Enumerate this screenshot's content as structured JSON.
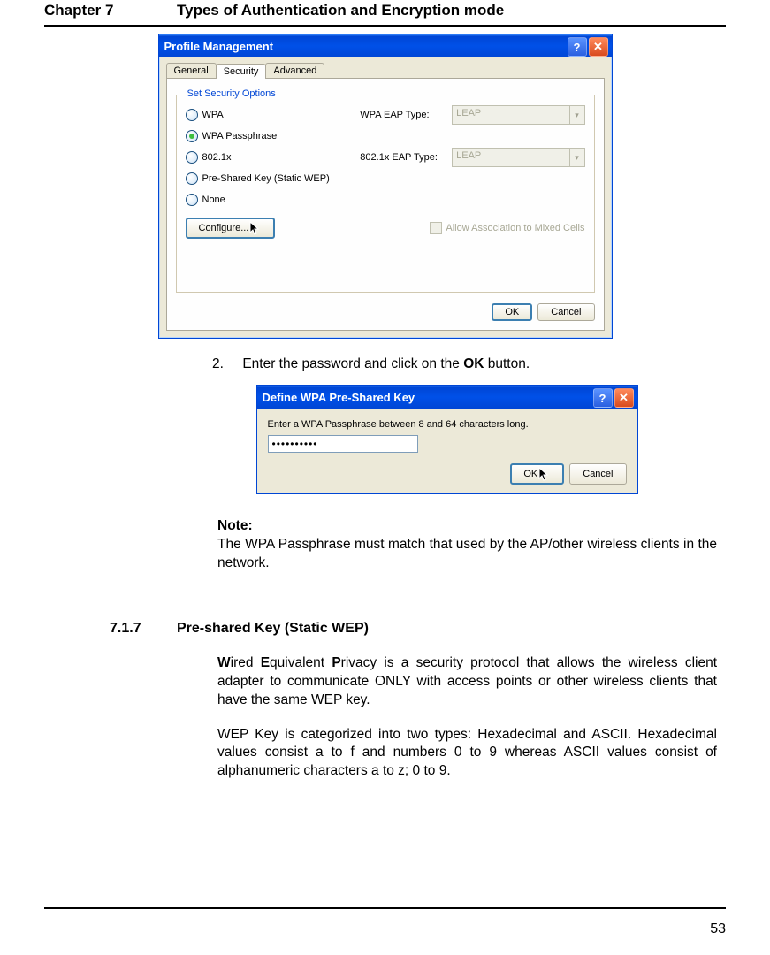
{
  "header": {
    "chapter": "Chapter 7",
    "title": "Types of Authentication and Encryption mode"
  },
  "dialog1": {
    "title": "Profile Management",
    "help_glyph": "?",
    "close_glyph": "✕",
    "tabs": {
      "general": "General",
      "security": "Security",
      "advanced": "Advanced"
    },
    "group_legend": "Set Security Options",
    "radios": {
      "wpa": "WPA",
      "wpapass": "WPA Passphrase",
      "dot1x": "802.1x",
      "psk": "Pre-Shared Key (Static WEP)",
      "none": "None"
    },
    "wpa_eap_label": "WPA EAP Type:",
    "dot1x_eap_label": "802.1x EAP Type:",
    "eap_value": "LEAP",
    "configure_label": "Configure...",
    "mixed_label": "Allow Association to Mixed Cells",
    "ok_label": "OK",
    "cancel_label": "Cancel"
  },
  "step2": {
    "num": "2.",
    "text_before": "Enter the password and click on the ",
    "ok_word": "OK",
    "text_after": " button."
  },
  "dialog2": {
    "title": "Define WPA Pre-Shared Key",
    "help_glyph": "?",
    "close_glyph": "✕",
    "instruction": "Enter a WPA Passphrase between 8 and 64 characters long.",
    "password_mask": "••••••••••",
    "ok_label": "OK",
    "cancel_label": "Cancel"
  },
  "note": {
    "label": "Note:",
    "text": "The WPA Passphrase must match that used by the AP/other wireless clients in the network."
  },
  "section": {
    "num": "7.1.7",
    "title": "Pre-shared Key (Static WEP)",
    "w": "W",
    "w_rest": "ired ",
    "e": "E",
    "e_rest": "quivalent ",
    "p": "P",
    "p_rest": "rivacy is a security protocol that allows the wireless client adapter to communicate ONLY with access points or other wireless clients that have the same WEP key.",
    "para2": "WEP Key is categorized into two types: Hexadecimal and ASCII. Hexadecimal values consist a to f and numbers 0 to 9 whereas ASCII values consist of alphanumeric characters a to z; 0 to 9."
  },
  "page_number": "53"
}
